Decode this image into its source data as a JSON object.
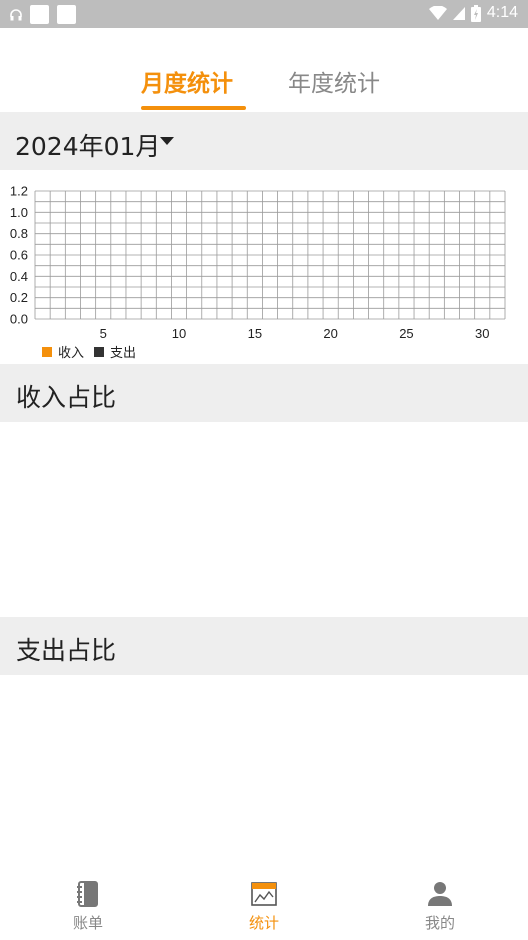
{
  "status_bar": {
    "time": "4:14"
  },
  "tabs": [
    {
      "label": "月度统计",
      "active": true
    },
    {
      "label": "年度统计",
      "active": false
    }
  ],
  "month_selector": {
    "label": "2024年01月"
  },
  "chart_data": {
    "type": "bar",
    "x_min": 1,
    "x_max": 31,
    "x_ticks": [
      "5",
      "10",
      "15",
      "20",
      "25",
      "30"
    ],
    "ylim": [
      0,
      1.2
    ],
    "y_ticks": [
      "0.0",
      "0.2",
      "0.4",
      "0.6",
      "0.8",
      "1.0",
      "1.2"
    ],
    "grid": true,
    "legend_position": "bottom-left",
    "series": [
      {
        "name": "收入",
        "color": "#f4900c",
        "values": []
      },
      {
        "name": "支出",
        "color": "#333333",
        "values": []
      }
    ]
  },
  "sections": {
    "income_title": "收入占比",
    "expense_title": "支出占比"
  },
  "bottom_nav": [
    {
      "label": "账单",
      "icon": "notebook-icon",
      "active": false
    },
    {
      "label": "统计",
      "icon": "chart-icon",
      "active": true
    },
    {
      "label": "我的",
      "icon": "person-icon",
      "active": false
    }
  ],
  "colors": {
    "accent": "#f4900c",
    "section_bg": "#eeeeee"
  }
}
